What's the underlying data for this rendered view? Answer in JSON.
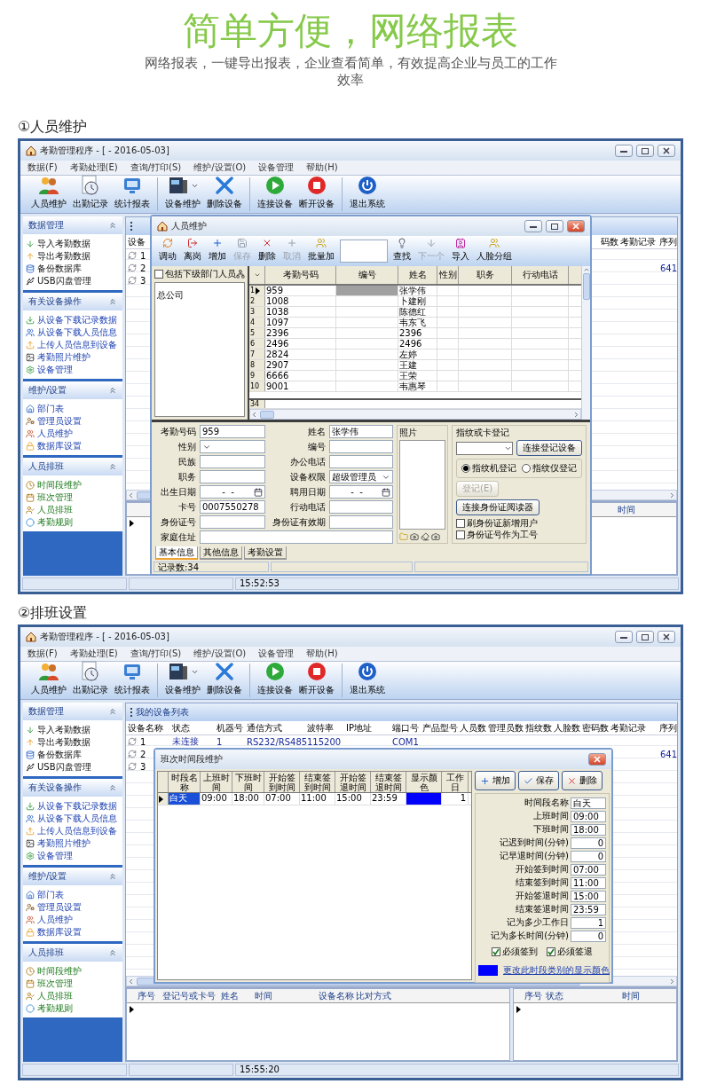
{
  "header": {
    "title": "简单方便，**网络报表**",
    "subtitle": "网络报表，一键导出报表，企业查看简单，有效提高企业与员工的工作效率"
  },
  "sections": [
    {
      "heading": "①人员维护",
      "window": {
        "title": "考勤管理程序 - [ - 2016-05-03]",
        "menu": [
          "数据(F)",
          "考勤处理(E)",
          "查询/打印(S)",
          "维护/设置(O)",
          "设备管理",
          "帮助(H)"
        ],
        "toolbar": [
          {
            "items": [
              {
                "label": "人员维护",
                "dropdown": false
              },
              {
                "label": "出勤记录",
                "dropdown": false
              },
              {
                "label": "统计报表",
                "dropdown": false
              }
            ]
          },
          {
            "items": [
              {
                "label": "设备维护",
                "dropdown": true
              },
              {
                "label": "删除设备",
                "dropdown": false
              }
            ]
          },
          {
            "items": [
              {
                "label": "连接设备",
                "dropdown": false
              },
              {
                "label": "断开设备",
                "dropdown": false
              }
            ]
          },
          {
            "items": [
              {
                "label": "退出系统",
                "dropdown": false
              }
            ]
          }
        ],
        "sidebar": [
          {
            "title": "数据管理",
            "items": [
              "导入考勤数据",
              "导出考勤数据",
              "备份数据库",
              "USB闪盘管理"
            ]
          },
          {
            "title": "有关设备操作",
            "items": [
              "从设备下载记录数据",
              "从设备下载人员信息",
              "上传人员信息到设备",
              "考勤照片维护",
              "设备管理"
            ]
          },
          {
            "title": "维护/设置",
            "items": [
              "部门表",
              "管理员设置",
              "人员维护",
              "数据库设置"
            ]
          },
          {
            "title": "人员排班",
            "items": [
              "时间段维护",
              "班次管理",
              "人员排班",
              "考勤规则"
            ]
          }
        ],
        "device_table": {
          "columns": [
            "设备"
          ],
          "trailing_columns": [
            "码数",
            "考勤记录",
            "序列"
          ],
          "rows": [
            {
              "cells": [
                "1"
              ]
            },
            {
              "cells": [
                "2"
              ],
              "trailing_cells": [
                "641"
              ]
            },
            {
              "cells": [
                "3"
              ]
            }
          ]
        },
        "status_table": {
          "trailing_columns": [
            "时间"
          ]
        },
        "status_bar": {
          "time": "15:52:53"
        },
        "dialog": {
          "kind": "person",
          "title": "人员维护",
          "toolbar": [
            {
              "kind": "button",
              "label": "调动",
              "disabled": false
            },
            {
              "kind": "button",
              "label": "离岗",
              "disabled": false
            },
            {
              "kind": "button",
              "label": "增加",
              "disabled": false
            },
            {
              "kind": "button",
              "label": "保存",
              "disabled": true
            },
            {
              "kind": "button",
              "label": "删除",
              "disabled": false
            },
            {
              "kind": "button",
              "label": "取消",
              "disabled": true
            },
            {
              "kind": "button",
              "label": "批量加",
              "disabled": false
            },
            {
              "kind": "field"
            },
            {
              "kind": "button",
              "label": "查找",
              "disabled": false
            },
            {
              "kind": "button",
              "label": "下一个",
              "disabled": true
            },
            {
              "kind": "button",
              "label": "导入",
              "disabled": false
            },
            {
              "kind": "button",
              "label": "人脸分组",
              "disabled": false
            }
          ],
          "department_filter": {
            "label": "包括下级部门人员",
            "checked": false
          },
          "tree": [
            "总公司"
          ],
          "grid": {
            "columns": [
              "考勤号码",
              "编号",
              "姓名",
              "性别",
              "职务",
              "行动电话"
            ],
            "rows": [
              {
                "number": "1",
                "attendance_no": "959",
                "name": "张学伟",
                "selected": true
              },
              {
                "number": "2",
                "attendance_no": "1008",
                "name": "卜建刚",
                "selected": false
              },
              {
                "number": "3",
                "attendance_no": "1038",
                "name": "陈德红",
                "selected": false
              },
              {
                "number": "4",
                "attendance_no": "1097",
                "name": "韦东飞",
                "selected": false
              },
              {
                "number": "5",
                "attendance_no": "2396",
                "name": "2396",
                "selected": false
              },
              {
                "number": "6",
                "attendance_no": "2496",
                "name": "2496",
                "selected": false
              },
              {
                "number": "7",
                "attendance_no": "2824",
                "name": "左婷",
                "selected": false
              },
              {
                "number": "8",
                "attendance_no": "2907",
                "name": "王建",
                "selected": false
              },
              {
                "number": "9",
                "attendance_no": "6666",
                "name": "王荣",
                "selected": false
              },
              {
                "number": "10",
                "attendance_no": "9001",
                "name": "韦惠琴",
                "selected": false
              }
            ],
            "footer": "34"
          },
          "form": {
            "left": [
              {
                "label": "考勤号码",
                "kind": "text",
                "value": "959"
              },
              {
                "label": "性别",
                "kind": "select"
              },
              {
                "label": "民族",
                "kind": "text"
              },
              {
                "label": "职务",
                "kind": "text"
              },
              {
                "label": "出生日期",
                "kind": "date",
                "value": "-  -"
              },
              {
                "label": "卡号",
                "kind": "text",
                "value": "0007550278"
              },
              {
                "label": "身份证号",
                "kind": "text"
              }
            ],
            "right": [
              {
                "label": "姓名",
                "kind": "text",
                "value": "张学伟"
              },
              {
                "label": "编号",
                "kind": "text"
              },
              {
                "label": "办公电话",
                "kind": "text"
              },
              {
                "label": "设备权限",
                "kind": "select",
                "value": "超级管理员"
              },
              {
                "label": "聘用日期",
                "kind": "date",
                "value": "-  -"
              },
              {
                "label": "行动电话",
                "kind": "text"
              },
              {
                "label": "身份证有效期",
                "kind": "text"
              }
            ],
            "address": {
              "label": "家庭住址"
            }
          },
          "photo": {
            "label": "照片"
          },
          "register": {
            "label": "指纹或卡登记",
            "connect_button": "连接登记设备",
            "radios": [
              {
                "label": "指纹机登记",
                "selected": true
              },
              {
                "label": "指纹仪登记",
                "selected": false
              }
            ],
            "register_button": {
              "label": "登记(E)",
              "disabled": true
            },
            "id_reader_button": "连接身份证阅读器",
            "checkboxes": [
              {
                "label": "刷身份证新增用户",
                "checked": false
              },
              {
                "label": "身份证号作为工号",
                "checked": false
              }
            ]
          },
          "tabs": [
            {
              "label": "基本信息",
              "selected": true
            },
            {
              "label": "其他信息",
              "selected": false
            },
            {
              "label": "考勤设置",
              "selected": false
            }
          ],
          "status": "记录数:34"
        }
      }
    },
    {
      "heading": "②排班设置",
      "window": {
        "title": "考勤管理程序 - [ - 2016-05-03]",
        "menu": [
          "数据(F)",
          "考勤处理(E)",
          "查询/打印(S)",
          "维护/设置(O)",
          "设备管理",
          "帮助(H)"
        ],
        "toolbar": [
          {
            "items": [
              {
                "label": "人员维护",
                "dropdown": false
              },
              {
                "label": "出勤记录",
                "dropdown": false
              },
              {
                "label": "统计报表",
                "dropdown": false
              }
            ]
          },
          {
            "items": [
              {
                "label": "设备维护",
                "dropdown": true
              },
              {
                "label": "删除设备",
                "dropdown": false
              }
            ]
          },
          {
            "items": [
              {
                "label": "连接设备",
                "dropdown": false
              },
              {
                "label": "断开设备",
                "dropdown": false
              }
            ]
          },
          {
            "items": [
              {
                "label": "退出系统",
                "dropdown": false
              }
            ]
          }
        ],
        "sidebar": [
          {
            "title": "数据管理",
            "items": [
              "导入考勤数据",
              "导出考勤数据",
              "备份数据库",
              "USB闪盘管理"
            ]
          },
          {
            "title": "有关设备操作",
            "items": [
              "从设备下载记录数据",
              "从设备下载人员信息",
              "上传人员信息到设备",
              "考勤照片维护",
              "设备管理"
            ]
          },
          {
            "title": "维护/设置",
            "items": [
              "部门表",
              "管理员设置",
              "人员维护",
              "数据库设置"
            ]
          },
          {
            "title": "人员排班",
            "items": [
              "时间段维护",
              "班次管理",
              "人员排班",
              "考勤规则"
            ]
          }
        ],
        "panel_title": "我的设备列表",
        "device_table": {
          "columns": [
            "设备名称",
            "状态",
            "机器号",
            "通信方式",
            "波特率",
            "IP地址",
            "端口号",
            "产品型号",
            "人员数",
            "管理员数",
            "指纹数",
            "人脸数",
            "密码数",
            "考勤记录"
          ],
          "trailing_columns": [
            "序列"
          ],
          "rows": [
            {
              "cells": [
                "1",
                "未连接",
                "1",
                "RS232/RS485",
                "115200",
                null,
                "COM1"
              ]
            },
            {
              "cells": [
                "2"
              ],
              "trailing_cells": [
                "641"
              ]
            },
            {
              "cells": [
                "3"
              ]
            }
          ]
        },
        "record_table": {
          "columns": [
            "序号",
            "登记号或卡号",
            "姓名",
            "时间",
            "设备名称",
            "比对方式"
          ]
        },
        "status_table": {
          "columns": [
            "序号",
            "状态",
            "时间"
          ]
        },
        "status_bar": {
          "time": "15:55:20"
        },
        "dialog": {
          "kind": "shift",
          "title": "班次时间段维护",
          "grid": {
            "columns": [
              "时段名称",
              "上班时间",
              "下班时间",
              "开始签到时间",
              "结束签到时间",
              "开始签退时间",
              "结束签退时间",
              "显示颜色",
              "工作日"
            ],
            "rows": [
              {
                "cells": [
                  "白天",
                  "09:00",
                  "18:00",
                  "07:00",
                  "11:00",
                  "15:00",
                  "23:59"
                ],
                "color": "#0000ff",
                "workdays": "1",
                "selected": true
              }
            ]
          },
          "buttons": [
            "增加",
            "保存",
            "删除"
          ],
          "fields": [
            {
              "label": "时间段名称",
              "value": "白天",
              "kind": "text"
            },
            {
              "label": "上班时间",
              "value": "09:00",
              "kind": "text"
            },
            {
              "label": "下班时间",
              "value": "18:00",
              "kind": "text"
            },
            {
              "label": "记迟到时间(分钟)",
              "value": "0",
              "kind": "number"
            },
            {
              "label": "记早退时间(分钟)",
              "value": "0",
              "kind": "number"
            },
            {
              "label": "开始签到时间",
              "value": "07:00",
              "kind": "text"
            },
            {
              "label": "结束签到时间",
              "value": "11:00",
              "kind": "text"
            },
            {
              "label": "开始签退时间",
              "value": "15:00",
              "kind": "text"
            },
            {
              "label": "结束签退时间",
              "value": "23:59",
              "kind": "text"
            },
            {
              "label": "记为多少工作日",
              "value": "1",
              "kind": "number"
            },
            {
              "label": "记为多长时间(分钟)",
              "value": "0",
              "kind": "number"
            }
          ],
          "checkboxes": [
            {
              "label": "必须签到",
              "checked": true
            },
            {
              "label": "必须签退",
              "checked": true
            }
          ],
          "color_link": {
            "label": "更改此时段类别的显示颜色",
            "color": "#0000ff"
          }
        }
      }
    }
  ]
}
